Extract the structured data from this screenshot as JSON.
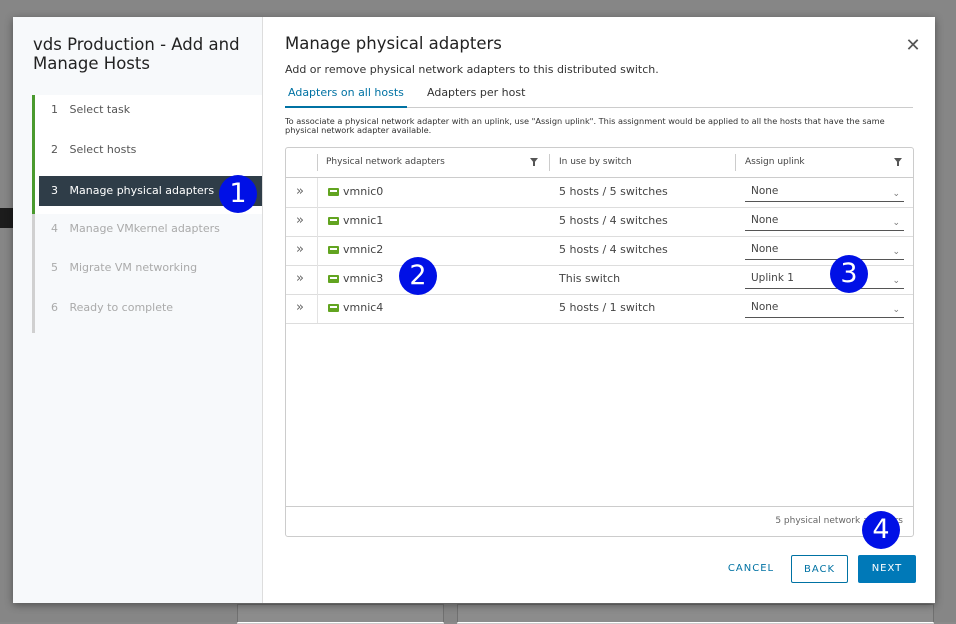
{
  "wizard": {
    "title": "vds Production - Add and Manage Hosts",
    "steps": [
      {
        "num": "1",
        "label": "Select task",
        "state": "done"
      },
      {
        "num": "2",
        "label": "Select hosts",
        "state": "done"
      },
      {
        "num": "3",
        "label": "Manage physical adapters",
        "state": "active"
      },
      {
        "num": "4",
        "label": "Manage VMkernel adapters",
        "state": "future"
      },
      {
        "num": "5",
        "label": "Migrate VM networking",
        "state": "future"
      },
      {
        "num": "6",
        "label": "Ready to complete",
        "state": "future"
      }
    ]
  },
  "page": {
    "title": "Manage physical adapters",
    "subtitle": "Add or remove physical network adapters to this distributed switch.",
    "close_icon": "close-icon",
    "tabs": [
      {
        "label": "Adapters on all hosts",
        "active": true
      },
      {
        "label": "Adapters per host",
        "active": false
      }
    ],
    "hint": "To associate a physical network adapter with an uplink, use \"Assign uplink\". This assignment would be applied to all the hosts that have the same physical network adapter available."
  },
  "grid": {
    "columns": [
      "Physical network adapters",
      "In use by switch",
      "Assign uplink"
    ],
    "rows": [
      {
        "name": "vmnic0",
        "in_use": "5 hosts / 5 switches",
        "uplink": "None"
      },
      {
        "name": "vmnic1",
        "in_use": "5 hosts / 4 switches",
        "uplink": "None"
      },
      {
        "name": "vmnic2",
        "in_use": "5 hosts / 4 switches",
        "uplink": "None"
      },
      {
        "name": "vmnic3",
        "in_use": "This switch",
        "uplink": "Uplink 1"
      },
      {
        "name": "vmnic4",
        "in_use": "5 hosts / 1 switch",
        "uplink": "None"
      }
    ],
    "footer": "5 physical network adapters"
  },
  "buttons": {
    "cancel": "CANCEL",
    "back": "BACK",
    "next": "NEXT"
  },
  "callouts": [
    "1",
    "2",
    "3",
    "4"
  ],
  "colors": {
    "accent": "#0079b8",
    "active_step_bg": "#2f3d48",
    "progress_green": "#4a9a2e",
    "callout": "#0010e6",
    "nic_icon": "#62a420"
  }
}
